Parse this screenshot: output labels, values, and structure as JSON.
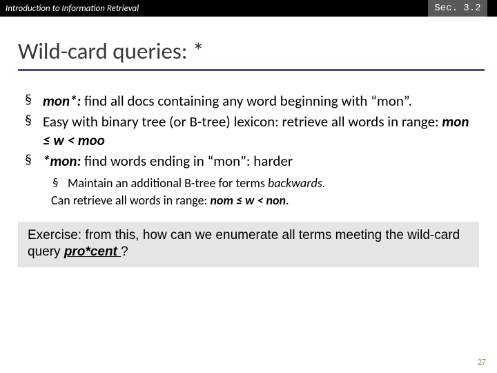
{
  "header": {
    "course": "Introduction to Information Retrieval",
    "section": "Sec. 3.2"
  },
  "title": "Wild-card queries: *",
  "bullets": {
    "b1": {
      "lead": "mon*:",
      "rest": " find all docs containing any word beginning with “mon”."
    },
    "b2": {
      "pre": "Easy with binary tree (or B-tree) lexicon: retrieve all words in range: ",
      "range": "mon ≤ w < moo"
    },
    "b3": {
      "lead": "*mon:",
      "rest": " find words ending in “mon”: harder"
    },
    "sub1": {
      "pre": "Maintain an additional B-tree for terms ",
      "em": "backwards."
    },
    "sub2": {
      "pre": "Can retrieve all words in range: ",
      "range": "nom ≤ w < non",
      "tail": "."
    }
  },
  "exercise": {
    "pre": "Exercise: from this, how can we enumerate all terms meeting the wild-card query ",
    "em": "pro*cent ",
    "tail": "?"
  },
  "slide_number": "27"
}
